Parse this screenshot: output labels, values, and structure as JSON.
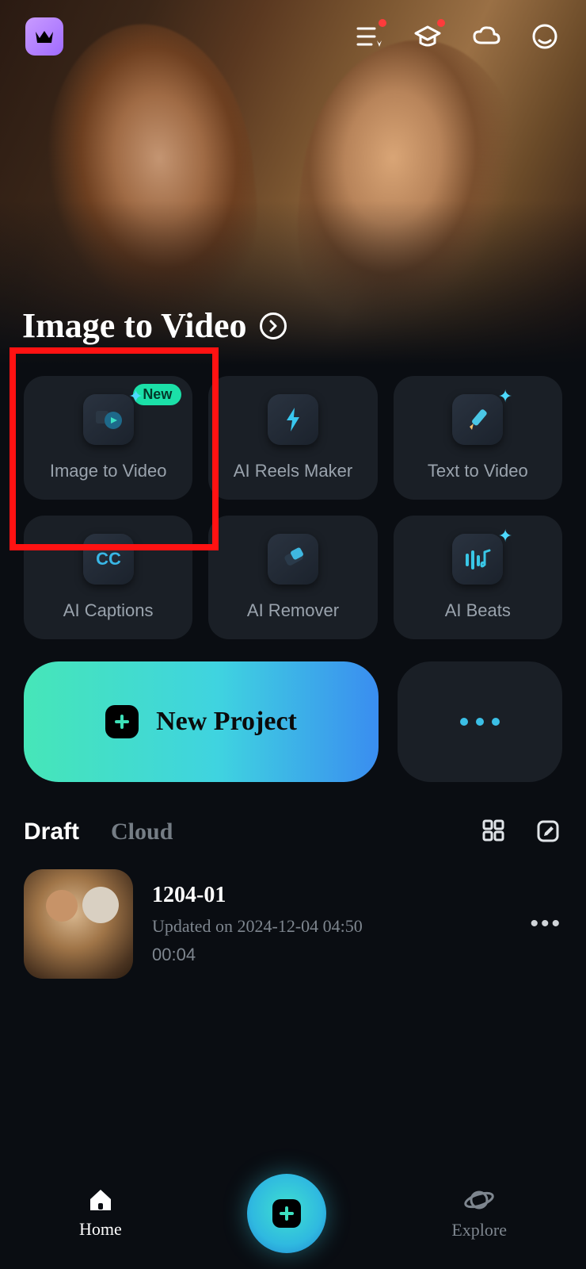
{
  "hero": {
    "title": "Image to Video"
  },
  "tools": [
    {
      "label": "Image to Video",
      "badge": "New"
    },
    {
      "label": "AI Reels Maker"
    },
    {
      "label": "Text to Video"
    },
    {
      "label": "AI Captions"
    },
    {
      "label": "AI Remover"
    },
    {
      "label": "AI Beats"
    }
  ],
  "actions": {
    "new_project": "New Project"
  },
  "tabs": {
    "draft": "Draft",
    "cloud": "Cloud"
  },
  "drafts": [
    {
      "title": "1204-01",
      "updated": "Updated on 2024-12-04 04:50",
      "duration": "00:04"
    }
  ],
  "nav": {
    "home": "Home",
    "explore": "Explore"
  }
}
